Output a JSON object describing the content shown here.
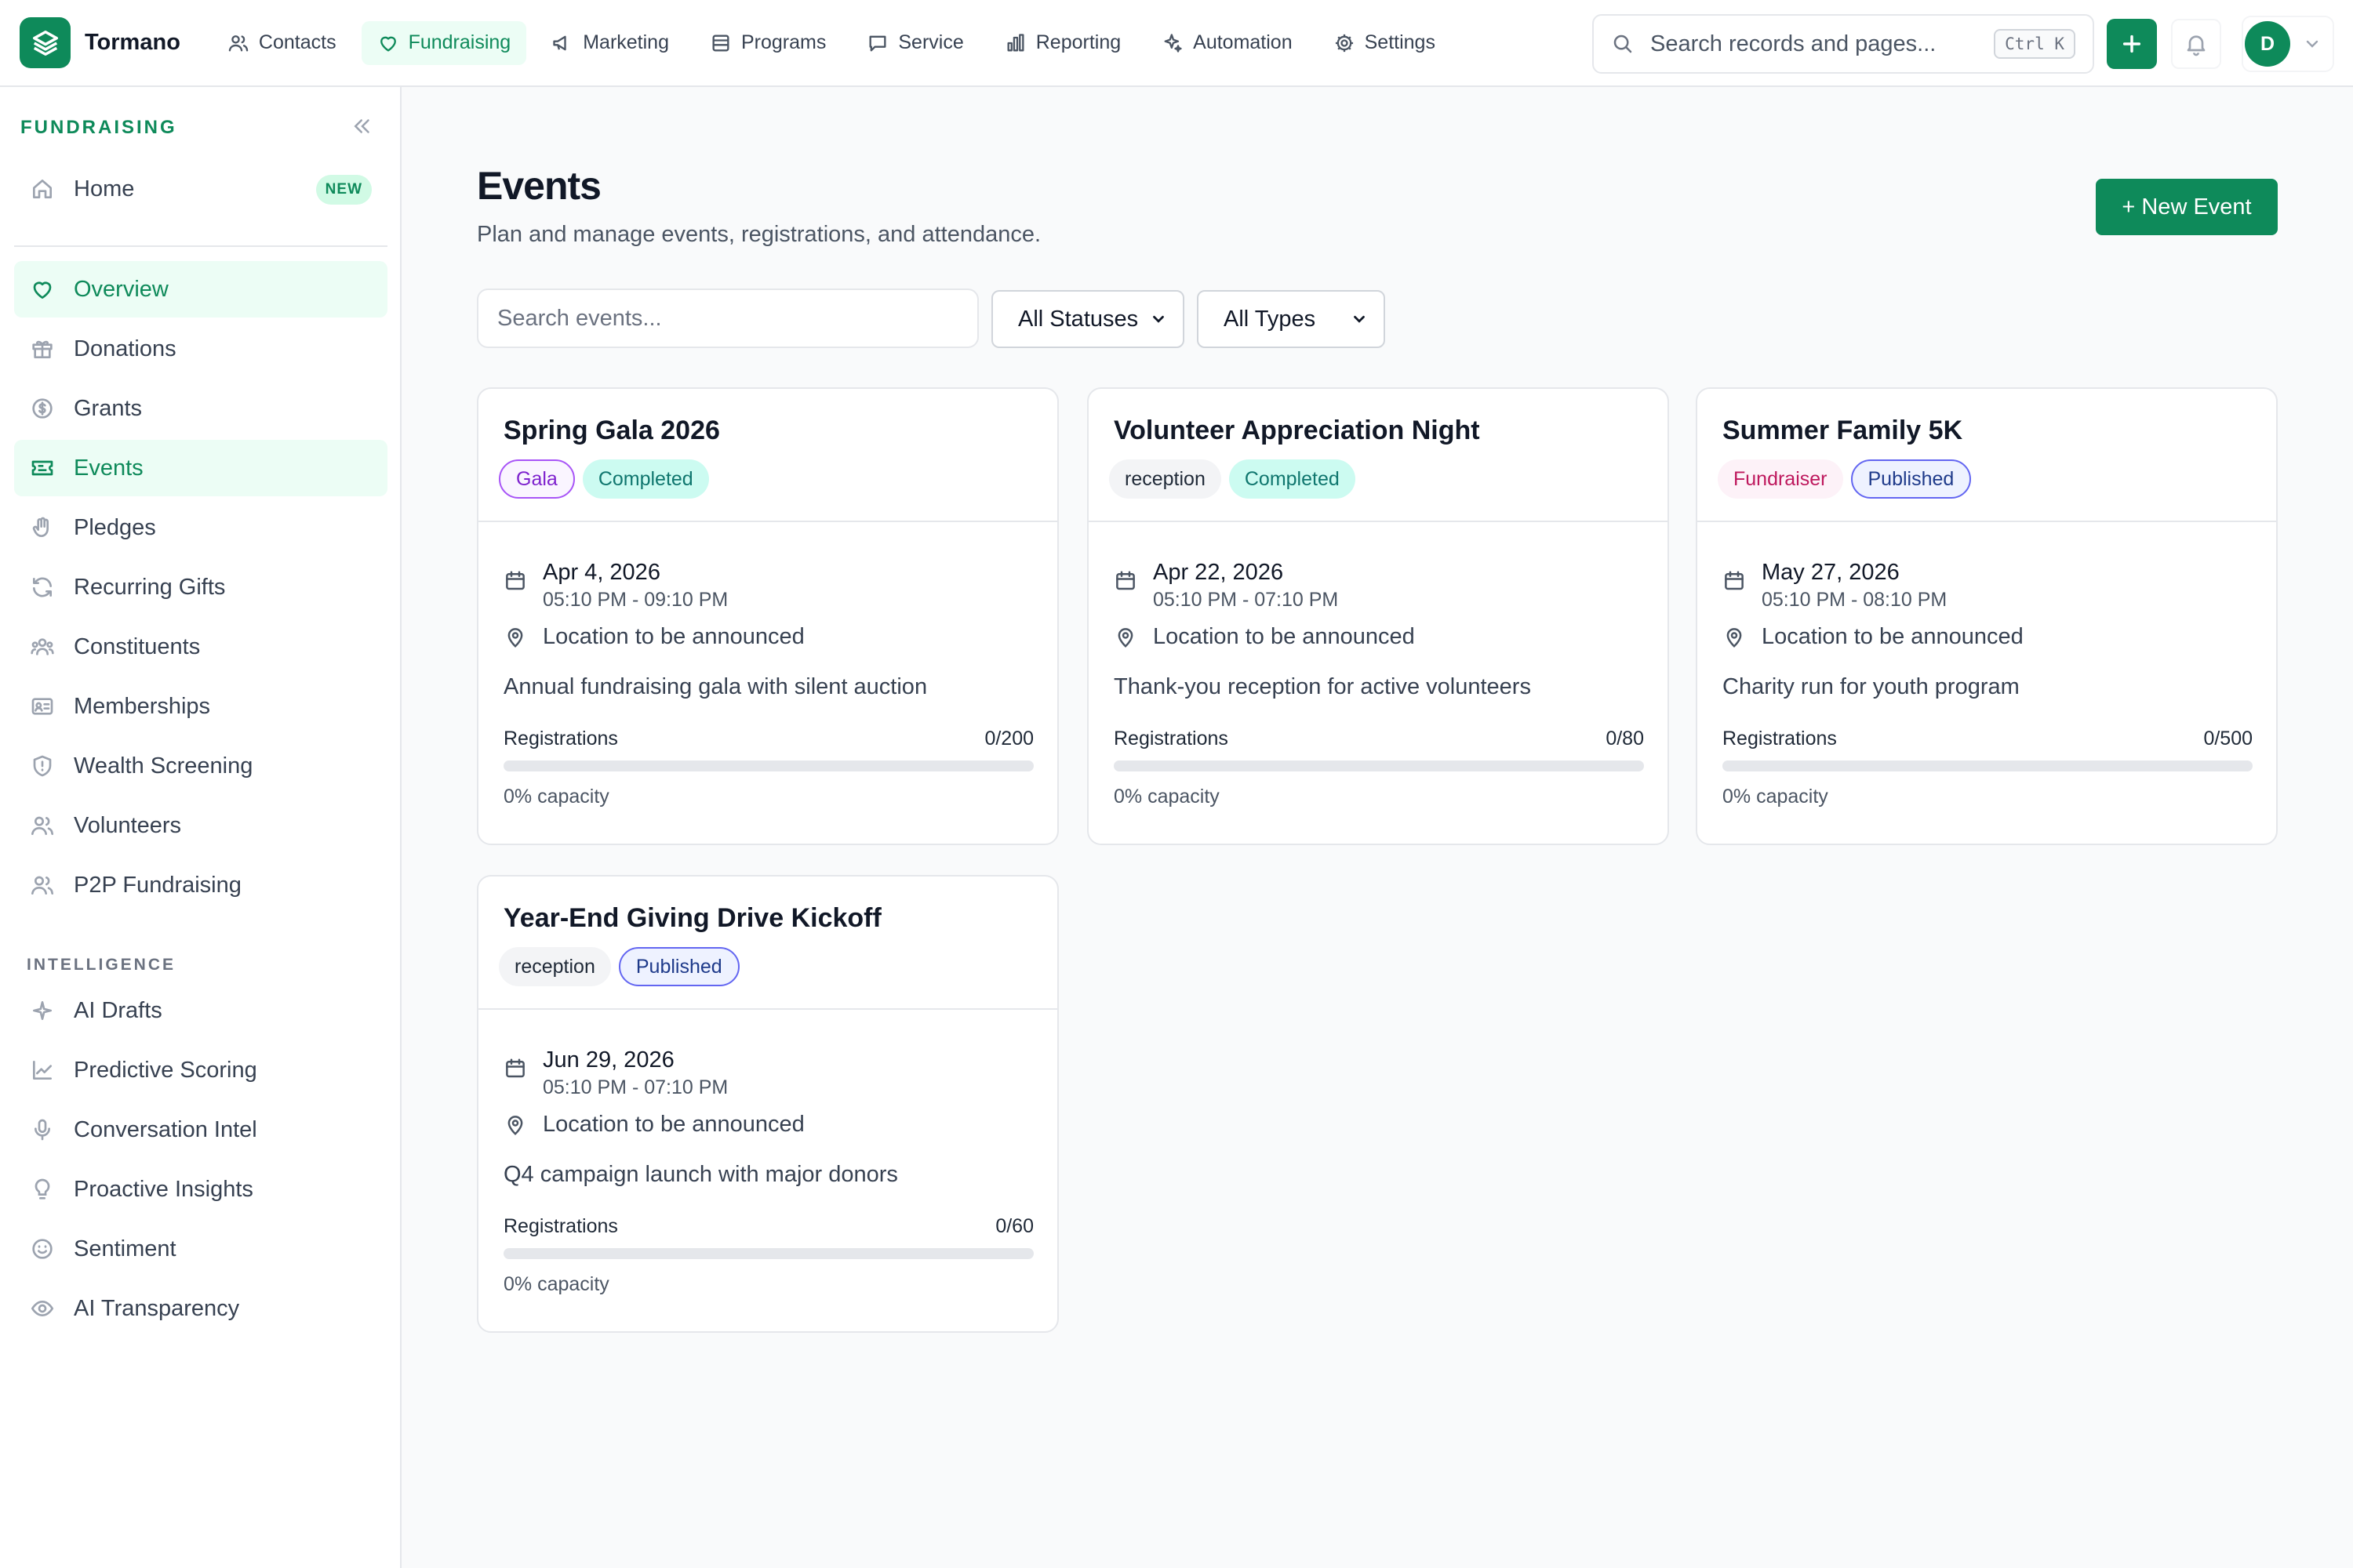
{
  "app": {
    "name": "Tormano"
  },
  "topnav": {
    "items": [
      {
        "label": "Contacts"
      },
      {
        "label": "Fundraising"
      },
      {
        "label": "Marketing"
      },
      {
        "label": "Programs"
      },
      {
        "label": "Service"
      },
      {
        "label": "Reporting"
      },
      {
        "label": "Automation"
      },
      {
        "label": "Settings"
      }
    ],
    "search_placeholder": "Search records and pages...",
    "shortcut": "Ctrl K",
    "user_initial": "D"
  },
  "sidebar": {
    "header": "FUNDRAISING",
    "home": {
      "label": "Home",
      "badge": "NEW"
    },
    "items": [
      {
        "label": "Overview"
      },
      {
        "label": "Donations"
      },
      {
        "label": "Grants"
      },
      {
        "label": "Events"
      },
      {
        "label": "Pledges"
      },
      {
        "label": "Recurring Gifts"
      },
      {
        "label": "Constituents"
      },
      {
        "label": "Memberships"
      },
      {
        "label": "Wealth Screening"
      },
      {
        "label": "Volunteers"
      },
      {
        "label": "P2P Fundraising"
      }
    ],
    "intel_header": "INTELLIGENCE",
    "intel_items": [
      {
        "label": "AI Drafts"
      },
      {
        "label": "Predictive Scoring"
      },
      {
        "label": "Conversation Intel"
      },
      {
        "label": "Proactive Insights"
      },
      {
        "label": "Sentiment"
      },
      {
        "label": "AI Transparency"
      }
    ]
  },
  "main": {
    "title": "Events",
    "subtitle": "Plan and manage events, registrations, and attendance.",
    "new_button": "+ New Event",
    "search_placeholder": "Search events...",
    "status_filter": "All Statuses",
    "type_filter": "All Types",
    "registrations_label": "Registrations",
    "events": [
      {
        "title": "Spring Gala 2026",
        "type": "Gala",
        "status": "Completed",
        "date": "Apr 4, 2026",
        "time": "05:10 PM - 09:10 PM",
        "location": "Location to be announced",
        "description": "Annual fundraising gala with silent auction",
        "registrations": "0/200",
        "registered": 0,
        "capacity": 200,
        "capacity_text": "0% capacity"
      },
      {
        "title": "Volunteer Appreciation Night",
        "type": "reception",
        "status": "Completed",
        "date": "Apr 22, 2026",
        "time": "05:10 PM - 07:10 PM",
        "location": "Location to be announced",
        "description": "Thank-you reception for active volunteers",
        "registrations": "0/80",
        "registered": 0,
        "capacity": 80,
        "capacity_text": "0% capacity"
      },
      {
        "title": "Summer Family 5K",
        "type": "Fundraiser",
        "status": "Published",
        "date": "May 27, 2026",
        "time": "05:10 PM - 08:10 PM",
        "location": "Location to be announced",
        "description": "Charity run for youth program",
        "registrations": "0/500",
        "registered": 0,
        "capacity": 500,
        "capacity_text": "0% capacity"
      },
      {
        "title": "Year-End Giving Drive Kickoff",
        "type": "reception",
        "status": "Published",
        "date": "Jun 29, 2026",
        "time": "05:10 PM - 07:10 PM",
        "location": "Location to be announced",
        "description": "Q4 campaign launch with major donors",
        "registrations": "0/60",
        "registered": 0,
        "capacity": 60,
        "capacity_text": "0% capacity"
      }
    ]
  },
  "colors": {
    "accent": "#0e8a5a",
    "accent_bg": "#ecfdf5",
    "border": "#e5e7eb",
    "page_bg": "#f9fafb"
  }
}
